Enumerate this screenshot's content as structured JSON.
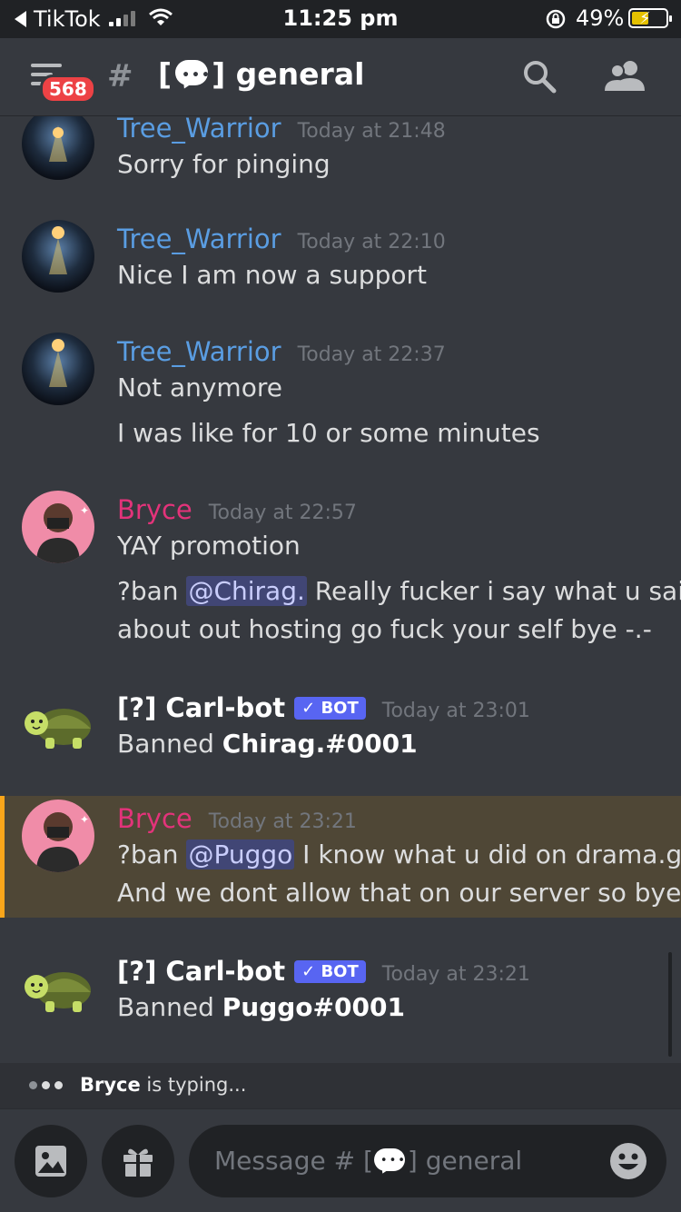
{
  "status_bar": {
    "back_app": "TikTok",
    "time": "11:25 pm",
    "battery_percent": "49%",
    "battery_level": 0.49,
    "icons": [
      "back-arrow-icon",
      "signal-icon",
      "wifi-icon",
      "rotation-lock-icon",
      "battery-charging-icon"
    ]
  },
  "header": {
    "unread_badge": "568",
    "hash": "#",
    "channel_prefix": "[",
    "channel_suffix": "] general",
    "icons": [
      "hamburger-icon",
      "speech-bubble-icon",
      "search-icon",
      "members-icon"
    ]
  },
  "messages": [
    {
      "author": "Tree_Warrior",
      "timestamp": "Today at 21:48",
      "lines": [
        "Sorry for pinging"
      ]
    },
    {
      "author": "Tree_Warrior",
      "timestamp": "Today at 22:10",
      "lines": [
        "Nice I am now a support"
      ]
    },
    {
      "author": "Tree_Warrior",
      "timestamp": "Today at 22:37",
      "lines": [
        "Not anymore",
        "I was like for 10 or some minutes"
      ]
    },
    {
      "author": "Bryce",
      "timestamp": "Today at 22:57",
      "line1": "YAY promotion",
      "line2_prefix": "?ban ",
      "line2_mention": "@Chirag.",
      "line2_suffix": " Really fucker i say what u said",
      "line3": "about out hosting go fuck your self bye -.-"
    },
    {
      "author": "[?] Carl-bot",
      "bot_tag": "✓ BOT",
      "timestamp": "Today at 23:01",
      "text": "Banned ",
      "bold": "Chirag.#0001"
    },
    {
      "author": "Bryce",
      "timestamp": "Today at 23:21",
      "highlighted": true,
      "line1_prefix": "?ban ",
      "line1_mention": "@Puggo",
      "line1_suffix": " I know what u did on drama.gg",
      "line2": "And we dont allow that on our server so bye"
    },
    {
      "author": "[?] Carl-bot",
      "bot_tag": "✓ BOT",
      "timestamp": "Today at 23:21",
      "text": "Banned ",
      "bold": "Puggo#0001"
    }
  ],
  "typing": {
    "user": "Bryce",
    "text": " is typing..."
  },
  "composer": {
    "placeholder_prefix": "Message # [",
    "placeholder_suffix": "] general",
    "icons": [
      "image-icon",
      "gift-icon",
      "emoji-icon"
    ]
  },
  "colors": {
    "background": "#36393f",
    "username_tree_warrior": "#5a9de2",
    "username_bryce": "#e3337a",
    "bot_tag": "#5865f2",
    "highlight_bg": "#4f4736",
    "highlight_border": "#faa61a",
    "badge": "#ed4245"
  }
}
